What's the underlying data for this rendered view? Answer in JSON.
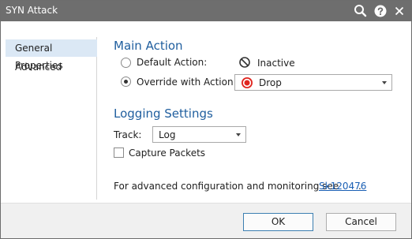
{
  "window": {
    "title": "SYN Attack",
    "icons": [
      "search-icon",
      "help-icon",
      "close-icon"
    ]
  },
  "sidebar": {
    "items": [
      {
        "label": "General Properties",
        "selected": true
      },
      {
        "label": "Advanced",
        "selected": false
      }
    ]
  },
  "main_action": {
    "section_title": "Main Action",
    "default_label": "Default Action:",
    "default_value": "Inactive",
    "default_icon": "inactive-icon",
    "override_label": "Override with Action:",
    "override_value": "Drop",
    "override_icon": "drop-icon",
    "selected_option": "override"
  },
  "logging": {
    "section_title": "Logging Settings",
    "track_label": "Track:",
    "track_value": "Log",
    "capture_label": "Capture Packets",
    "capture_checked": false
  },
  "footer_note": {
    "text": "For advanced configuration and monitoring see",
    "link_text": "Sk120476",
    "suffix": "."
  },
  "buttons": {
    "ok": "OK",
    "cancel": "Cancel"
  },
  "colors": {
    "titlebar": "#6e6e6e",
    "section_title": "#1f5e9e",
    "link": "#1a5fb4",
    "sidebar_selected": "#dbe8f5",
    "drop_red": "#e0261f"
  }
}
